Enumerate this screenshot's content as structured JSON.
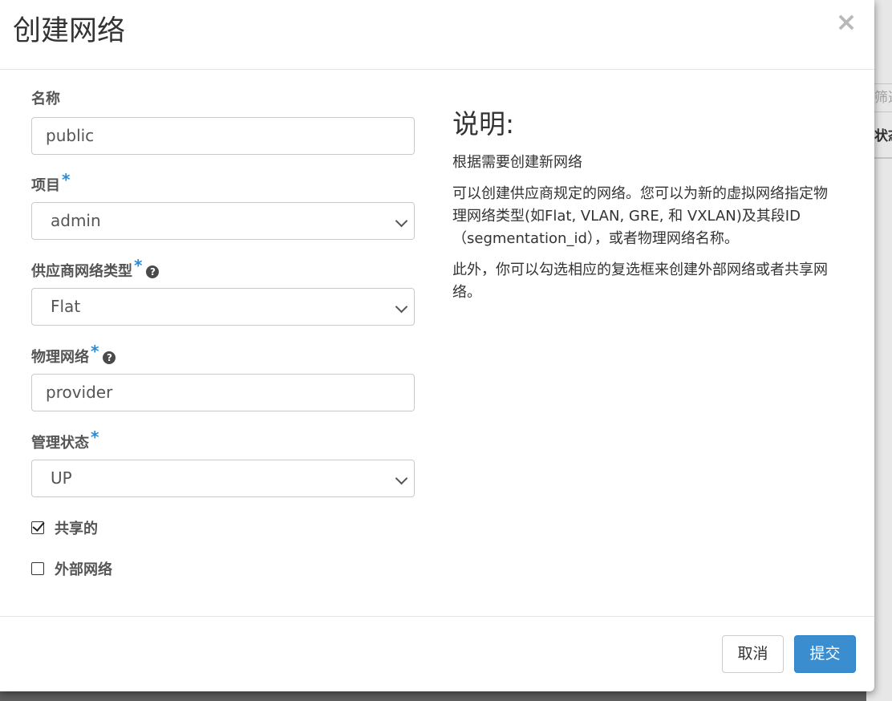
{
  "background": {
    "filter_text": "筛选",
    "status_header": "状态"
  },
  "modal": {
    "title": "创建网络",
    "close_symbol": "×"
  },
  "form": {
    "name": {
      "label": "名称",
      "value": "public"
    },
    "project": {
      "label": "项目",
      "required": "*",
      "value": "admin"
    },
    "provider_network_type": {
      "label": "供应商网络类型",
      "required": "*",
      "help": "?",
      "value": "Flat"
    },
    "physical_network": {
      "label": "物理网络",
      "required": "*",
      "help": "?",
      "value": "provider"
    },
    "admin_state": {
      "label": "管理状态",
      "required": "*",
      "value": "UP"
    },
    "shared": {
      "label": "共享的",
      "checked": true
    },
    "external": {
      "label": "外部网络",
      "checked": false
    }
  },
  "help": {
    "title": "说明:",
    "paragraphs": [
      "根据需要创建新网络",
      "可以创建供应商规定的网络。您可以为新的虚拟网络指定物理网络类型(如Flat, VLAN, GRE, 和 VXLAN)及其段ID（segmentation_id），或者物理网络名称。",
      "此外，你可以勾选相应的复选框来创建外部网络或者共享网络。"
    ]
  },
  "footer": {
    "cancel_label": "取消",
    "submit_label": "提交"
  },
  "colors": {
    "primary": "#3a8ed0",
    "required_marker": "#2e8ad0",
    "overlay": "#5f5f5f"
  }
}
